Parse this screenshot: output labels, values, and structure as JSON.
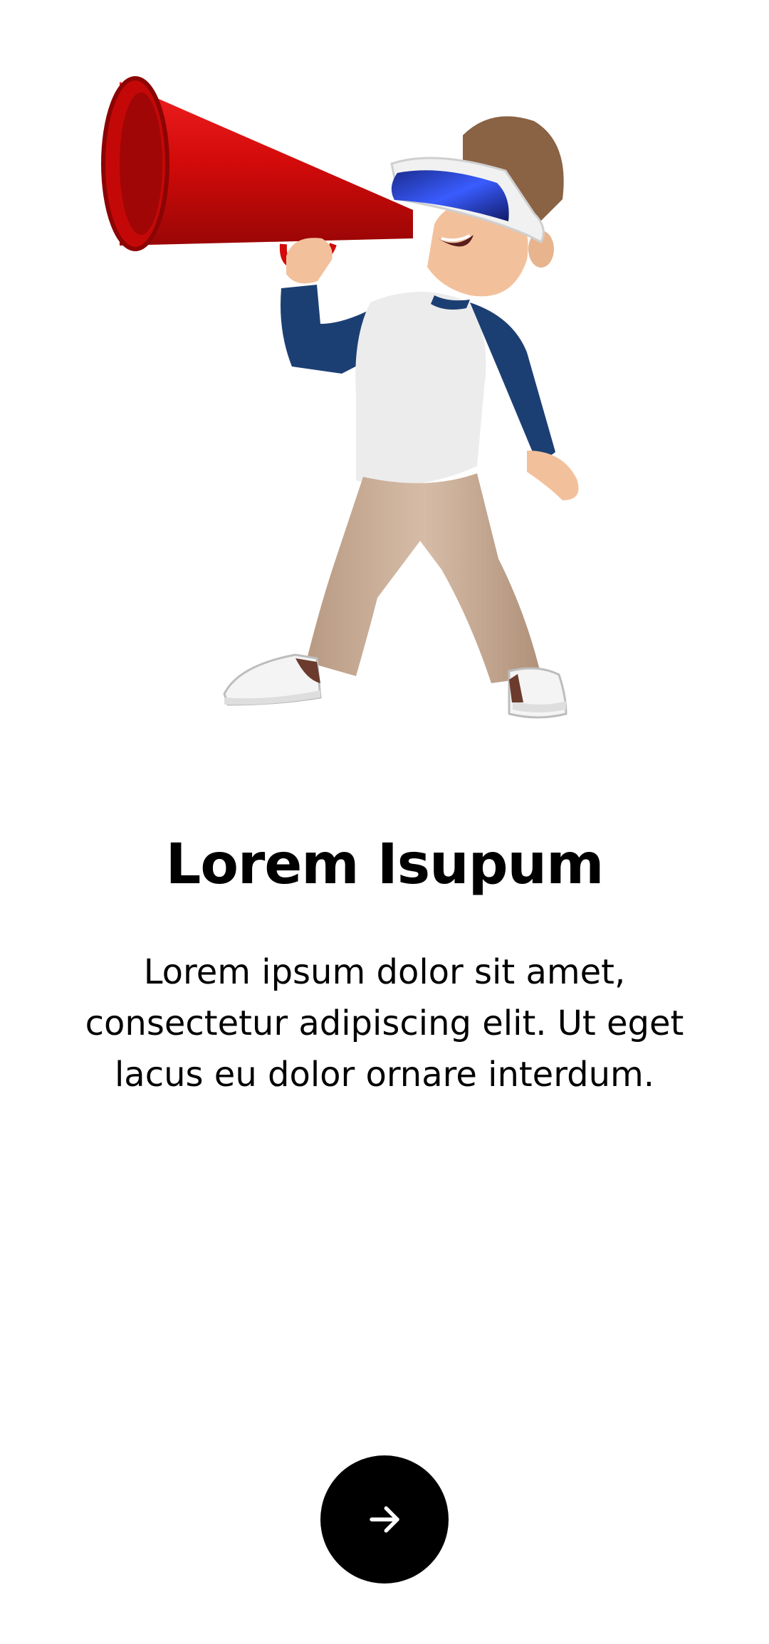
{
  "onboarding": {
    "illustration": "boy-with-vr-headset-and-megaphone",
    "title": "Lorem Isupum",
    "body": "Lorem ipsum dolor sit amet, consectetur adipiscing elit. Ut eget lacus eu dolor ornare interdum.",
    "next_icon": "arrow-right-icon"
  },
  "colors": {
    "background": "#ffffff",
    "text": "#000000",
    "button": "#000000",
    "button_icon": "#ffffff",
    "megaphone": "#d20a0a",
    "shirt_sleeves": "#1c3f73",
    "shirt_body": "#ececec",
    "pants": "#c9ad96",
    "visor": "#2540b8"
  }
}
